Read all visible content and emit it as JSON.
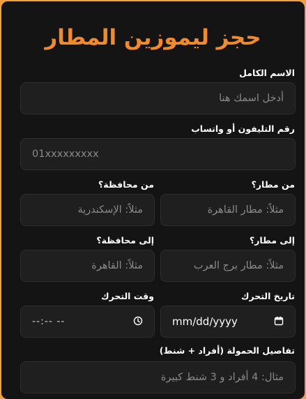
{
  "form": {
    "title": "حجز ليموزين المطار",
    "full_name": {
      "label": "الاسم الكامل",
      "placeholder": "أدخل اسمك هنا"
    },
    "phone": {
      "label": "رقم التليفون أو واتساب",
      "placeholder": "01xxxxxxxxx"
    },
    "from_airport": {
      "label": "من مطار؟",
      "placeholder": "مثلاً: مطار القاهرة"
    },
    "from_governorate": {
      "label": "من محافظة؟",
      "placeholder": "مثلاً: الإسكندرية"
    },
    "to_airport": {
      "label": "إلى مطار؟",
      "placeholder": "مثلاً: مطار برج العرب"
    },
    "to_governorate": {
      "label": "إلى محافظة؟",
      "placeholder": "مثلاً: القاهرة"
    },
    "date": {
      "label": "تاريخ التحرك",
      "value": "mm/dd/yyyy"
    },
    "time": {
      "label": "وقت التحرك",
      "value": "--:-- --"
    },
    "cargo": {
      "label": "تفاصيل الحمولة (أفراد + شنط)",
      "placeholder": "مثال: 4 أفراد و 3 شنط كبيرة"
    }
  },
  "colors": {
    "accent": "#f08a2c",
    "frame": "#f1a13b",
    "card": "#141414",
    "field": "#1f1f1f"
  },
  "icons": {
    "date": "calendar-icon",
    "time": "clock-icon"
  }
}
